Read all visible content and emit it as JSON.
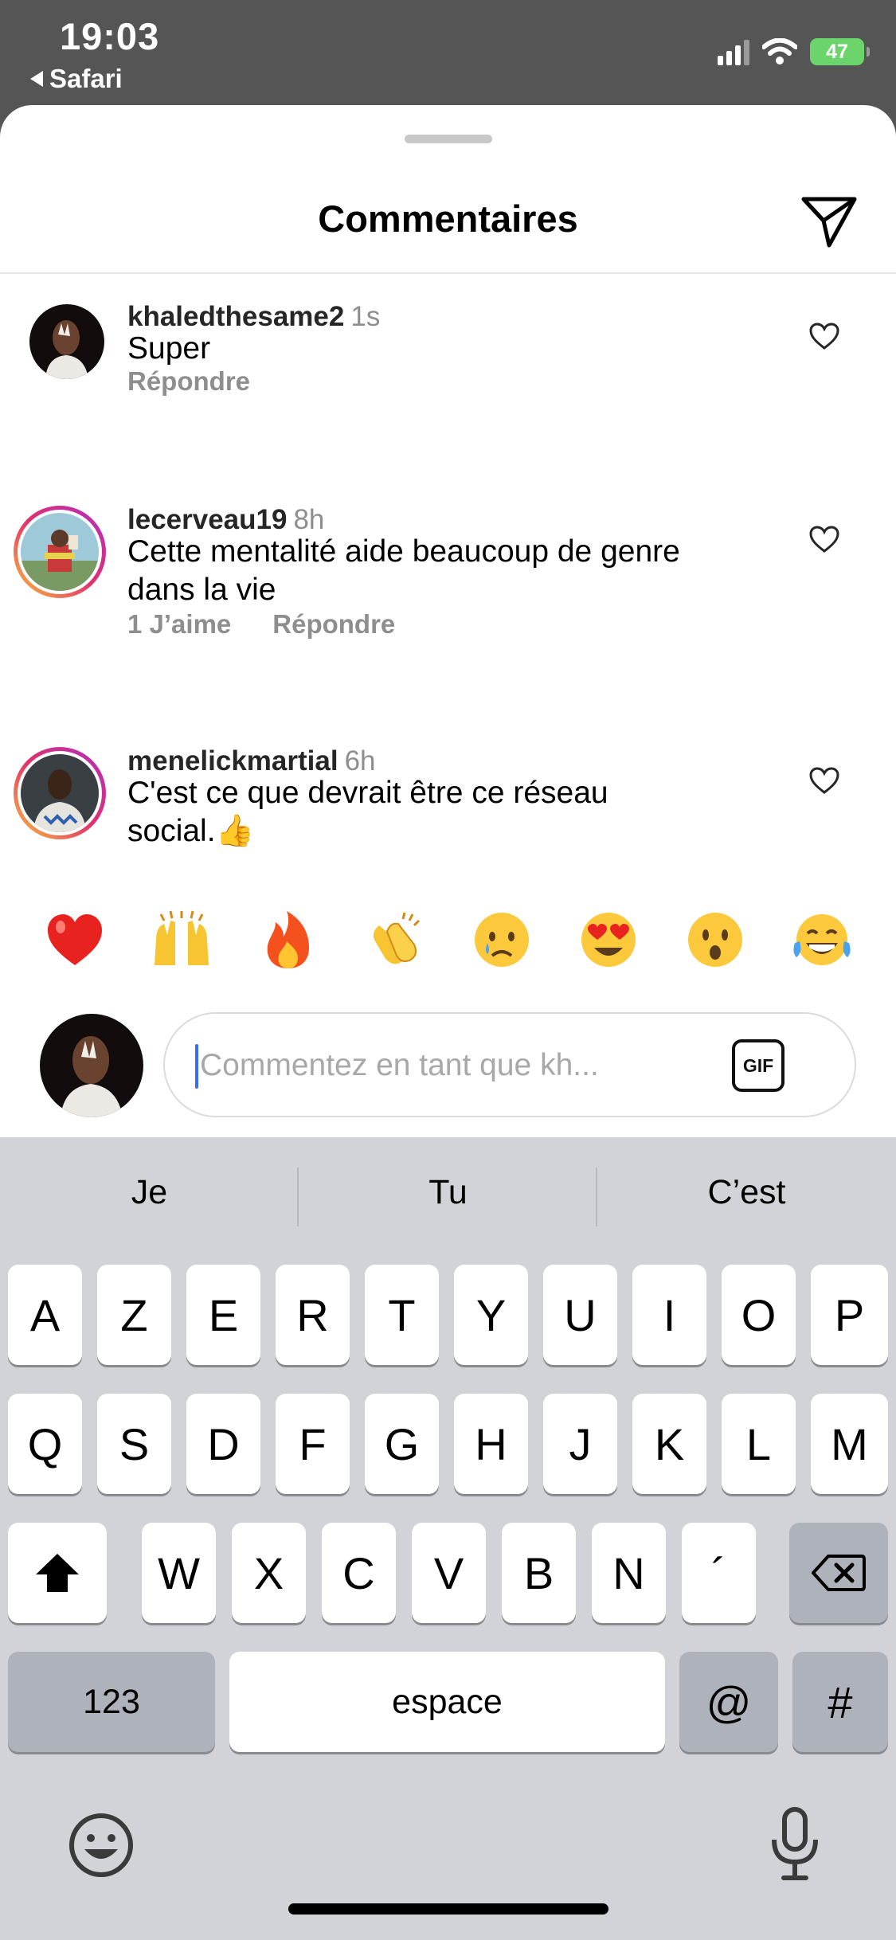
{
  "status_bar": {
    "time": "19:03",
    "back_app": "Safari",
    "battery": "47"
  },
  "sheet": {
    "title": "Commentaires",
    "comments": [
      {
        "username": "khaledthesame2",
        "time": "1s",
        "text": "Super",
        "likes": "",
        "reply_label": "Répondre"
      },
      {
        "username": "lecerveau19",
        "time": "8h",
        "text": "Cette mentalité aide beaucoup de genre dans la vie",
        "likes": "1 J’aime",
        "reply_label": "Répondre"
      },
      {
        "username": "menelickmartial",
        "time": "6h",
        "text": "C'est ce que devrait être ce réseau social.👍",
        "likes": "",
        "reply_label": ""
      }
    ],
    "quick_reactions": [
      "red-heart",
      "raising-hands",
      "fire",
      "clapping-hands",
      "crying-face",
      "heart-eyes",
      "astonished-face",
      "tears-of-joy"
    ]
  },
  "composer": {
    "placeholder": "Commentez en tant que kh...",
    "value": "",
    "gif_label": "GIF"
  },
  "keyboard": {
    "suggestions": [
      "Je",
      "Tu",
      "C’est"
    ],
    "row1": [
      "A",
      "Z",
      "E",
      "R",
      "T",
      "Y",
      "U",
      "I",
      "O",
      "P"
    ],
    "row2": [
      "Q",
      "S",
      "D",
      "F",
      "G",
      "H",
      "J",
      "K",
      "L",
      "M"
    ],
    "row3": [
      "W",
      "X",
      "C",
      "V",
      "B",
      "N",
      "´"
    ],
    "numbers_label": "123",
    "space_label": "espace",
    "at_label": "@",
    "hash_label": "#"
  },
  "colors": {
    "accent_caret": "#3b6cf6",
    "story_ring": "#e1306c",
    "battery": "#6bd46b"
  }
}
